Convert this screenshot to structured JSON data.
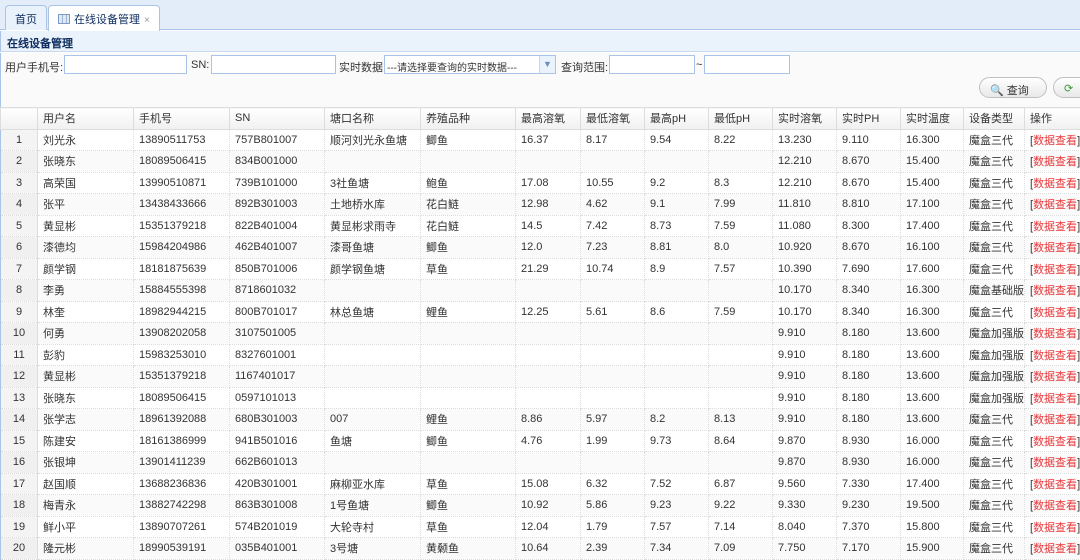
{
  "tabs": [
    {
      "label": "首页"
    },
    {
      "label": "在线设备管理",
      "close": "×"
    }
  ],
  "panel_title": "在线设备管理",
  "filters": {
    "phone_label": "用户手机号:",
    "phone_value": "",
    "sn_label": "SN:",
    "sn_value": "",
    "realtime_label": "实时数据:",
    "realtime_selected": "---请选择要查询的实时数据---",
    "range_label": "查询范围:",
    "range_from": "",
    "range_sep": "~",
    "range_to": ""
  },
  "buttons": {
    "query": "查询"
  },
  "columns": [
    "",
    "用户名",
    "手机号",
    "SN",
    "塘口名称",
    "养殖品种",
    "最高溶氧",
    "最低溶氧",
    "最高pH",
    "最低pH",
    "实时溶氧",
    "实时PH",
    "实时温度",
    "设备类型",
    "操作"
  ],
  "action_label": "数据查看",
  "rows": [
    [
      "1",
      "刘光永",
      "13890511753",
      "757B801007",
      "顺河刘光永鱼塘",
      "鲫鱼",
      "16.37",
      "8.17",
      "9.54",
      "8.22",
      "13.230",
      "9.110",
      "16.300",
      "魔盒三代"
    ],
    [
      "2",
      "张晓东",
      "18089506415",
      "834B001000",
      "",
      "",
      "",
      "",
      "",
      "",
      "12.210",
      "8.670",
      "15.400",
      "魔盒三代"
    ],
    [
      "3",
      "高荣国",
      "13990510871",
      "739B101000",
      "3社鱼塘",
      "鲍鱼",
      "17.08",
      "10.55",
      "9.2",
      "8.3",
      "12.210",
      "8.670",
      "15.400",
      "魔盒三代"
    ],
    [
      "4",
      "张平",
      "13438433666",
      "892B301003",
      "土地桥水库",
      "花白鲢",
      "12.98",
      "4.62",
      "9.1",
      "7.99",
      "11.810",
      "8.810",
      "17.100",
      "魔盒三代"
    ],
    [
      "5",
      "黄显彬",
      "15351379218",
      "822B401004",
      "黄显彬求雨寺",
      "花白鲢",
      "14.5",
      "7.42",
      "8.73",
      "7.59",
      "11.080",
      "8.300",
      "17.400",
      "魔盒三代"
    ],
    [
      "6",
      "漆德均",
      "15984204986",
      "462B401007",
      "漆哥鱼塘",
      "鲫鱼",
      "12.0",
      "7.23",
      "8.81",
      "8.0",
      "10.920",
      "8.670",
      "16.100",
      "魔盒三代"
    ],
    [
      "7",
      "颜学钢",
      "18181875639",
      "850B701006",
      "颜学钢鱼塘",
      "草鱼",
      "21.29",
      "10.74",
      "8.9",
      "7.57",
      "10.390",
      "7.690",
      "17.600",
      "魔盒三代"
    ],
    [
      "8",
      "李勇",
      "15884555398",
      "8718601032",
      "",
      "",
      "",
      "",
      "",
      "",
      "10.170",
      "8.340",
      "16.300",
      "魔盒基础版"
    ],
    [
      "9",
      "林奎",
      "18982944215",
      "800B701017",
      "林总鱼塘",
      "鲤鱼",
      "12.25",
      "5.61",
      "8.6",
      "7.59",
      "10.170",
      "8.340",
      "16.300",
      "魔盒三代"
    ],
    [
      "10",
      "何勇",
      "13908202058",
      "3107501005",
      "",
      "",
      "",
      "",
      "",
      "",
      "9.910",
      "8.180",
      "13.600",
      "魔盒加强版"
    ],
    [
      "11",
      "彭豹",
      "15983253010",
      "8327601001",
      "",
      "",
      "",
      "",
      "",
      "",
      "9.910",
      "8.180",
      "13.600",
      "魔盒加强版"
    ],
    [
      "12",
      "黄显彬",
      "15351379218",
      "1167401017",
      "",
      "",
      "",
      "",
      "",
      "",
      "9.910",
      "8.180",
      "13.600",
      "魔盒加强版"
    ],
    [
      "13",
      "张晓东",
      "18089506415",
      "0597101013",
      "",
      "",
      "",
      "",
      "",
      "",
      "9.910",
      "8.180",
      "13.600",
      "魔盒加强版"
    ],
    [
      "14",
      "张学志",
      "18961392088",
      "680B301003",
      "007",
      "鲤鱼",
      "8.86",
      "5.97",
      "8.2",
      "8.13",
      "9.910",
      "8.180",
      "13.600",
      "魔盒三代"
    ],
    [
      "15",
      "陈建安",
      "18161386999",
      "941B501016",
      "鱼塘",
      "鲫鱼",
      "4.76",
      "1.99",
      "9.73",
      "8.64",
      "9.870",
      "8.930",
      "16.000",
      "魔盒三代"
    ],
    [
      "16",
      "张银坤",
      "13901411239",
      "662B601013",
      "",
      "",
      "",
      "",
      "",
      "",
      "9.870",
      "8.930",
      "16.000",
      "魔盒三代"
    ],
    [
      "17",
      "赵国顺",
      "13688236836",
      "420B301001",
      "麻柳亚水库",
      "草鱼",
      "15.08",
      "6.32",
      "7.52",
      "6.87",
      "9.560",
      "7.330",
      "17.400",
      "魔盒三代"
    ],
    [
      "18",
      "梅青永",
      "13882742298",
      "863B301008",
      "1号鱼塘",
      "鲫鱼",
      "10.92",
      "5.86",
      "9.23",
      "9.22",
      "9.330",
      "9.230",
      "19.500",
      "魔盒三代"
    ],
    [
      "19",
      "鲜小平",
      "13890707261",
      "574B201019",
      "大轮寺村",
      "草鱼",
      "12.04",
      "1.79",
      "7.57",
      "7.14",
      "8.040",
      "7.370",
      "15.800",
      "魔盒三代"
    ],
    [
      "20",
      "隆元彬",
      "18990539191",
      "035B401001",
      "3号塘",
      "黄颡鱼",
      "10.64",
      "2.39",
      "7.34",
      "7.09",
      "7.750",
      "7.170",
      "15.900",
      "魔盒三代"
    ]
  ]
}
